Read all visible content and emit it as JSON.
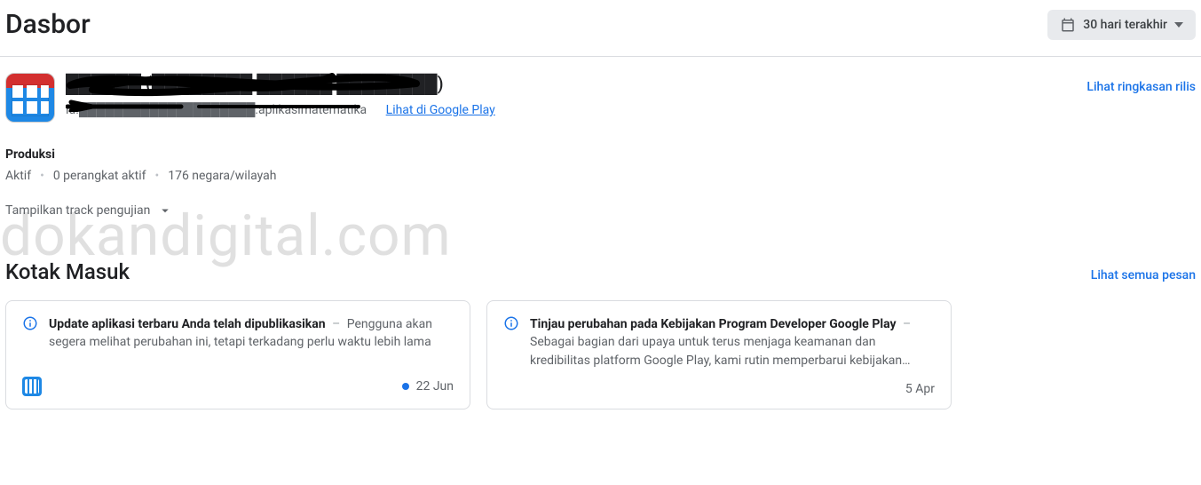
{
  "header": {
    "title": "Dasbor",
    "date_range_label": "30 hari terakhir"
  },
  "app": {
    "name_redacted": "██████ (████████ ██████ ████████)",
    "package_redacted": "id.████████████████████.aplikasimatematika",
    "view_in_play_label": "Lihat di Google Play",
    "release_summary_label": "Lihat ringkasan rilis"
  },
  "production": {
    "section_label": "Produksi",
    "status": "Aktif",
    "devices": "0 perangkat aktif",
    "countries": "176 negara/wilayah",
    "show_testing_tracks_label": "Tampilkan track pengujian"
  },
  "watermark": "dokandigital.com",
  "inbox": {
    "title": "Kotak Masuk",
    "view_all_label": "Lihat semua pesan",
    "messages": [
      {
        "title": "Update aplikasi terbaru Anda telah dipublikasikan",
        "body": "Pengguna akan segera melihat perubahan ini, tetapi terkadang perlu waktu lebih lama",
        "date": "22 Jun",
        "unread": true,
        "has_app_icon": true
      },
      {
        "title": "Tinjau perubahan pada Kebijakan Program Developer Google Play",
        "body": "Sebagai bagian dari upaya untuk terus menjaga keamanan dan kredibilitas platform Google Play, kami rutin memperbarui kebijakan…",
        "date": "5 Apr",
        "unread": false,
        "has_app_icon": false
      }
    ]
  }
}
